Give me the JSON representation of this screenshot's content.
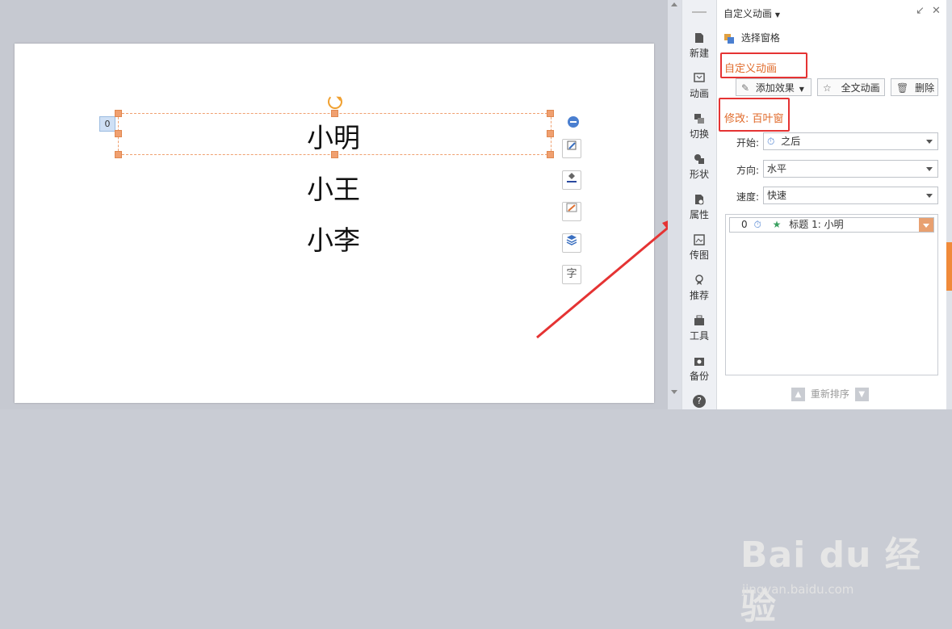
{
  "slide": {
    "anim_index": "0",
    "lines": [
      "小明",
      "小王",
      "小李"
    ]
  },
  "float_tools": {
    "font_icon_glyph": "字"
  },
  "sidebar": {
    "items": [
      {
        "label": "新建",
        "icon": "new-doc-icon"
      },
      {
        "label": "动画",
        "icon": "animation-icon"
      },
      {
        "label": "切换",
        "icon": "transition-icon"
      },
      {
        "label": "形状",
        "icon": "shape-icon"
      },
      {
        "label": "属性",
        "icon": "properties-icon"
      },
      {
        "label": "传图",
        "icon": "upload-image-icon"
      },
      {
        "label": "推荐",
        "icon": "recommend-icon"
      },
      {
        "label": "工具",
        "icon": "toolbox-icon"
      },
      {
        "label": "备份",
        "icon": "backup-icon"
      }
    ],
    "help_icon": "help-icon",
    "help_glyph": "?"
  },
  "panel": {
    "title": "自定义动画",
    "select_pane_label": "选择窗格",
    "custom_anim_heading": "自定义动画",
    "add_effect_label": "添加效果",
    "full_text_anim_label": "全文动画",
    "delete_label": "删除",
    "modify_heading": "修改: 百叶窗",
    "start_label": "开始:",
    "start_value": "之后",
    "direction_label": "方向:",
    "direction_value": "水平",
    "speed_label": "速度:",
    "speed_value": "快速",
    "anim_item": {
      "index": "0",
      "text": "标题 1: 小明"
    },
    "reorder_label": "重新排序"
  },
  "watermark": {
    "main": "Bai du 经验",
    "sub": "jingyan.baidu.com"
  },
  "colors": {
    "accent": "#e06a2a",
    "highlight_box": "#e53333",
    "arrow": "#e53333"
  }
}
